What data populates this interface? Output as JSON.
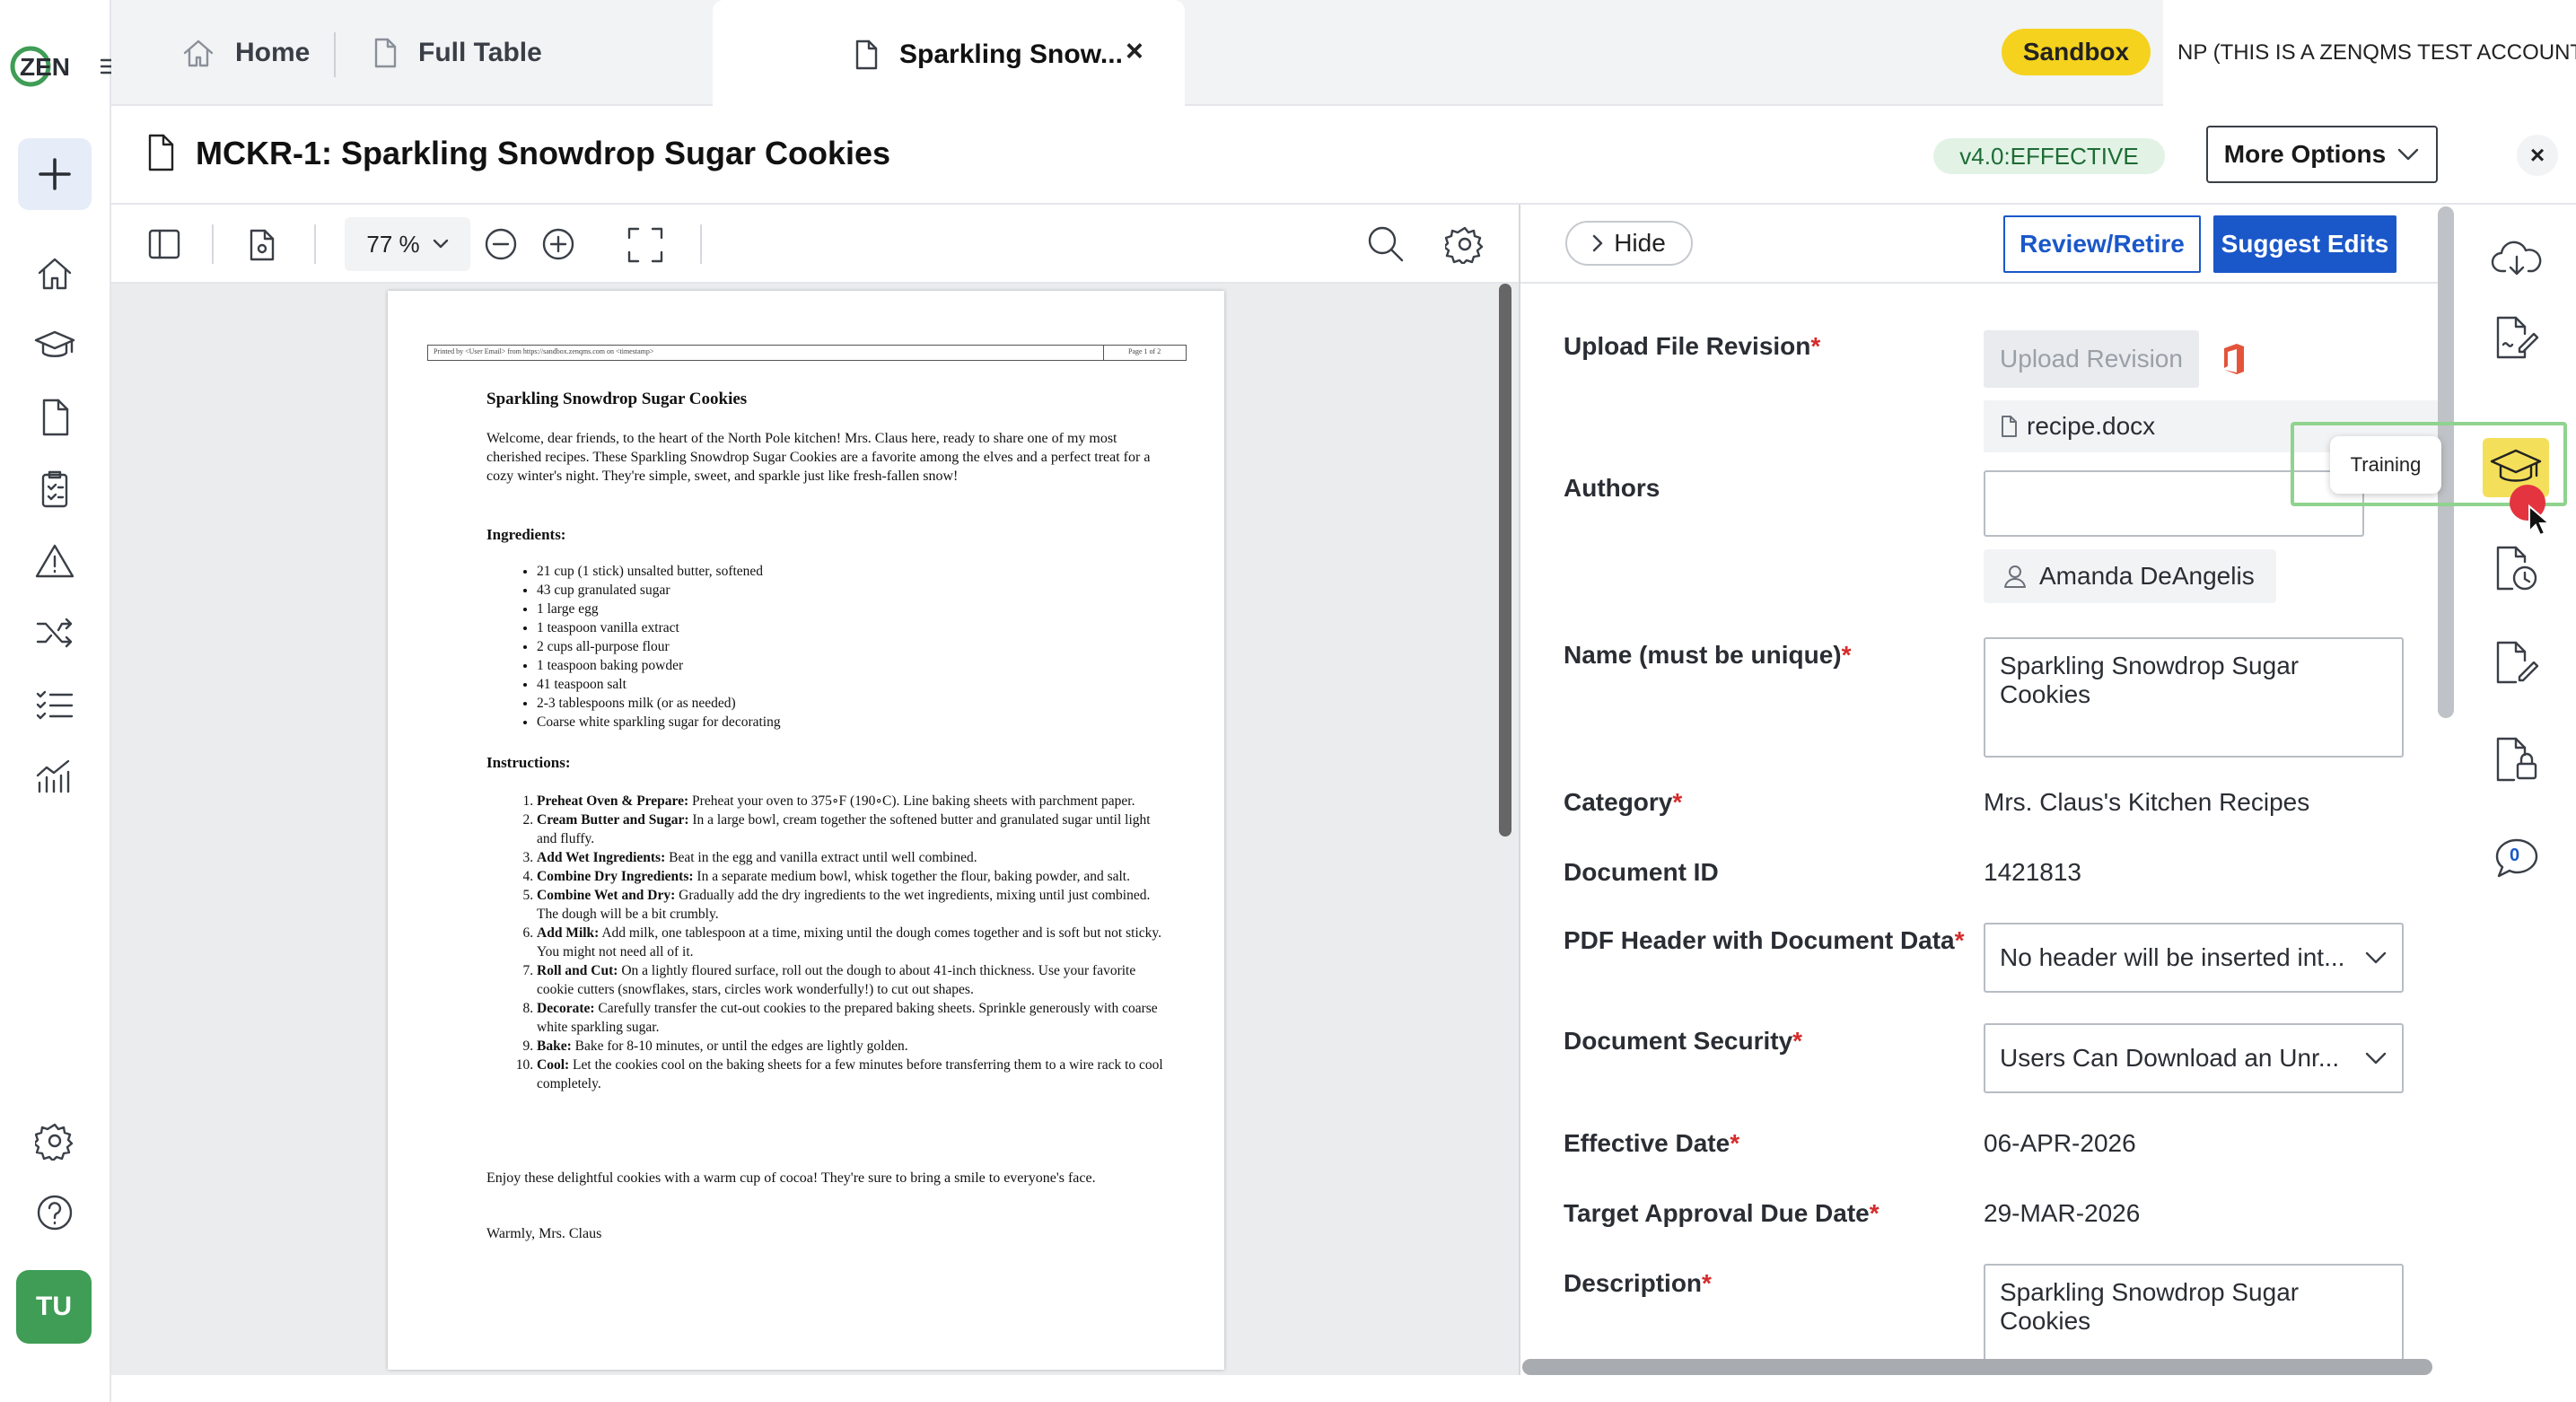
{
  "app": {
    "logo": "ZEN"
  },
  "rail": {
    "items": [
      "new-plus-icon",
      "home-icon",
      "training-cap-icon",
      "document-icon",
      "checklist-clipboard-icon",
      "warning-triangle-icon",
      "shuffle-icon",
      "task-list-icon",
      "analytics-icon",
      "settings-gear-icon",
      "help-icon"
    ],
    "avatar_initials": "TU"
  },
  "tabs": [
    {
      "label": "Home",
      "icon": "home-icon"
    },
    {
      "label": "Full Table",
      "icon": "document-icon"
    },
    {
      "label": "Sparkling Snow...",
      "icon": "document-icon",
      "active": true,
      "close": "×"
    }
  ],
  "header": {
    "sandbox_badge": "Sandbox",
    "account_name": "NP (THIS IS A ZENQMS TEST ACCOUNT)"
  },
  "document": {
    "title": "MCKR-1: Sparkling Snowdrop Sugar Cookies",
    "version_badge": "v4.0:EFFECTIVE",
    "more_options": "More Options",
    "close": "×"
  },
  "viewer": {
    "zoom_level": "77 %",
    "page": {
      "banner_left": "Printed by <User Email> from https://sandbox.zenqms.com on <timestamp>",
      "banner_right": "Page 1 of 2",
      "title": "Sparkling Snowdrop Sugar Cookies",
      "intro": "Welcome, dear friends, to the heart of the North Pole kitchen! Mrs. Claus here, ready to share one of my most cherished recipes. These Sparkling Snowdrop Sugar Cookies are a favorite among the elves and a perfect treat for a cozy winter's night. They're simple, sweet, and sparkle just like fresh-fallen snow!",
      "ingredients_heading": "Ingredients:",
      "ingredients": [
        "21 cup (1 stick) unsalted butter, softened",
        "43 cup granulated sugar",
        "1 large egg",
        "1 teaspoon vanilla extract",
        "2 cups all-purpose flour",
        "1 teaspoon baking powder",
        "41 teaspoon salt",
        "2-3 tablespoons milk (or as needed)",
        "Coarse white sparkling sugar for decorating"
      ],
      "instructions_heading": "Instructions:",
      "instructions": [
        {
          "bold": "Preheat Oven & Prepare:",
          "text": " Preheat your oven to 375∘F (190∘C). Line baking sheets with parchment paper."
        },
        {
          "bold": "Cream Butter and Sugar:",
          "text": " In a large bowl, cream together the softened butter and granulated sugar until light and fluffy."
        },
        {
          "bold": "Add Wet Ingredients:",
          "text": " Beat in the egg and vanilla extract until well combined."
        },
        {
          "bold": "Combine Dry Ingredients:",
          "text": " In a separate medium bowl, whisk together the flour, baking powder, and salt."
        },
        {
          "bold": "Combine Wet and Dry:",
          "text": " Gradually add the dry ingredients to the wet ingredients, mixing until just combined. The dough will be a bit crumbly."
        },
        {
          "bold": "Add Milk:",
          "text": " Add milk, one tablespoon at a time, mixing until the dough comes together and is soft but not sticky. You might not need all of it."
        },
        {
          "bold": "Roll and Cut:",
          "text": " On a lightly floured surface, roll out the dough to about 41-inch thickness. Use your favorite cookie cutters (snowflakes, stars, circles work wonderfully!) to cut out shapes."
        },
        {
          "bold": "Decorate:",
          "text": " Carefully transfer the cut-out cookies to the prepared baking sheets. Sprinkle generously with coarse white sparkling sugar."
        },
        {
          "bold": "Bake:",
          "text": " Bake for 8-10 minutes, or until the edges are lightly golden."
        },
        {
          "bold": "Cool:",
          "text": " Let the cookies cool on the baking sheets for a few minutes before transferring them to a wire rack to cool completely."
        }
      ],
      "closing": "Enjoy these delightful cookies with a warm cup of cocoa! They're sure to bring a smile to everyone's face.",
      "signoff": "Warmly, Mrs. Claus"
    }
  },
  "panel": {
    "hide_label": "Hide",
    "review_retire": "Review/Retire",
    "suggest_edits": "Suggest Edits",
    "required_mark": "*",
    "fields": {
      "upload_label": "Upload File Revision",
      "upload_button": "Upload Revision",
      "file_name": "recipe.docx",
      "authors_label": "Authors",
      "author_name": "Amanda DeAngelis",
      "name_label": "Name (must be unique)",
      "name_value": "Sparkling Snowdrop Sugar Cookies",
      "category_label": "Category",
      "category_value": "Mrs. Claus's Kitchen Recipes",
      "docid_label": "Document ID",
      "docid_value": "1421813",
      "pdfheader_label": "PDF Header with Document Data",
      "pdfheader_value": "No header will be inserted int...",
      "security_label": "Document Security",
      "security_value": "Users Can Download an Unr...",
      "effective_label": "Effective Date",
      "effective_value": "06-APR-2026",
      "target_label": "Target Approval Due Date",
      "target_value": "29-MAR-2026",
      "description_label": "Description",
      "description_value": "Sparkling Snowdrop Sugar Cookies"
    }
  },
  "right_rail": {
    "items": [
      "cloud-download-icon",
      "signature-doc-icon",
      "training-cap-icon",
      "doc-history-icon",
      "doc-edit-icon",
      "doc-lock-icon",
      "comments-icon"
    ],
    "comments_count": "0",
    "tooltip": "Training"
  },
  "colors": {
    "accent": "#1a57c9",
    "sandbox": "#f5d21e",
    "effective_bg": "#e2f3e6",
    "avatar": "#3f9d56",
    "required": "#d52b2b"
  }
}
